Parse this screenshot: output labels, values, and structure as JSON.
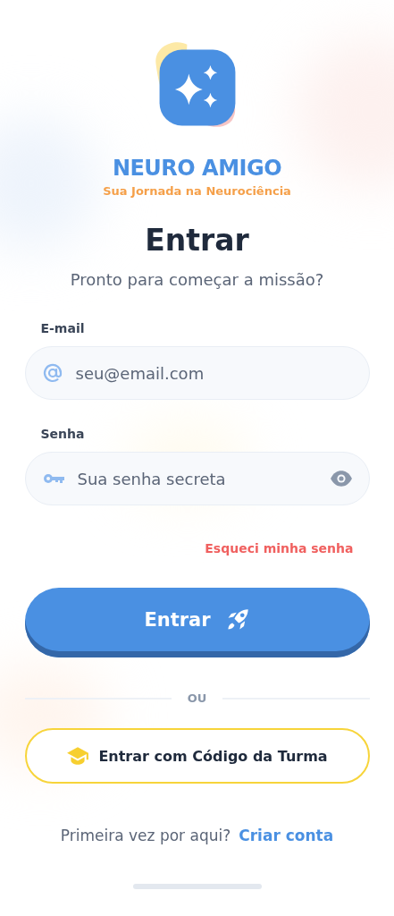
{
  "brand": {
    "name": "NEURO AMIGO",
    "tagline": "Sua Jornada na Neurociência"
  },
  "heading": "Entrar",
  "subheading": "Pronto para começar a missão?",
  "fields": [
    {
      "kind": "email",
      "label": "E-mail",
      "placeholder": "seu@email.com"
    },
    {
      "kind": "password",
      "label": "Senha",
      "placeholder": "Sua senha secreta"
    }
  ],
  "forgot_link": "Esqueci minha senha",
  "primary_button": "Entrar",
  "divider": "OU",
  "class_code_button": "Entrar com Código da Turma",
  "signup": {
    "prompt": "Primeira vez por aqui?",
    "link": "Criar conta"
  }
}
